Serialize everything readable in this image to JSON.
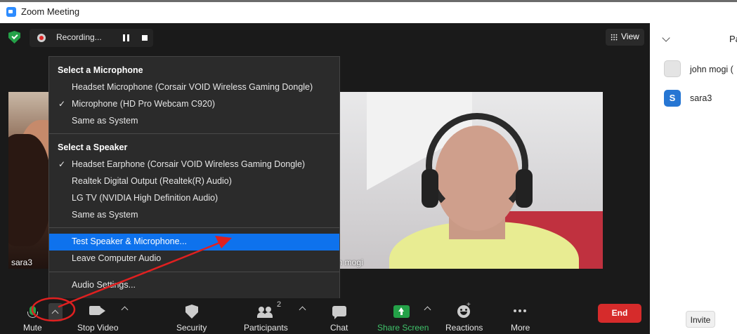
{
  "window": {
    "title": "Zoom Meeting"
  },
  "recording": {
    "label": "Recording..."
  },
  "view_button": {
    "label": "View"
  },
  "audio_menu": {
    "microphone_header": "Select a Microphone",
    "microphones": [
      {
        "label": "Headset Microphone (Corsair VOID Wireless Gaming Dongle)",
        "checked": false
      },
      {
        "label": "Microphone (HD Pro Webcam C920)",
        "checked": true
      },
      {
        "label": "Same as System",
        "checked": false
      }
    ],
    "speaker_header": "Select a Speaker",
    "speakers": [
      {
        "label": "Headset Earphone (Corsair VOID Wireless Gaming Dongle)",
        "checked": true
      },
      {
        "label": "Realtek Digital Output (Realtek(R) Audio)",
        "checked": false
      },
      {
        "label": "LG TV (NVIDIA High Definition Audio)",
        "checked": false
      },
      {
        "label": "Same as System",
        "checked": false
      }
    ],
    "test_label": "Test Speaker & Microphone...",
    "leave_label": "Leave Computer Audio",
    "settings_label": "Audio Settings...",
    "check_glyph": "✓"
  },
  "videos": {
    "left_name": "sara3",
    "right_name": "hn mogi"
  },
  "toolbar": {
    "mute": "Mute",
    "stop_video": "Stop Video",
    "security": "Security",
    "participants": "Participants",
    "participants_count": "2",
    "chat": "Chat",
    "share_screen": "Share Screen",
    "reactions": "Reactions",
    "more": "More",
    "end": "End"
  },
  "side_panel": {
    "title": "Pa",
    "participants": [
      {
        "name": "john mogi (",
        "avatar": ""
      },
      {
        "name": "sara3",
        "avatar": "S"
      }
    ],
    "invite": "Invite"
  },
  "colors": {
    "highlight": "#0e72ed",
    "share_green": "#24a148",
    "end_red": "#d62b2b",
    "annotation_red": "#e02020"
  }
}
